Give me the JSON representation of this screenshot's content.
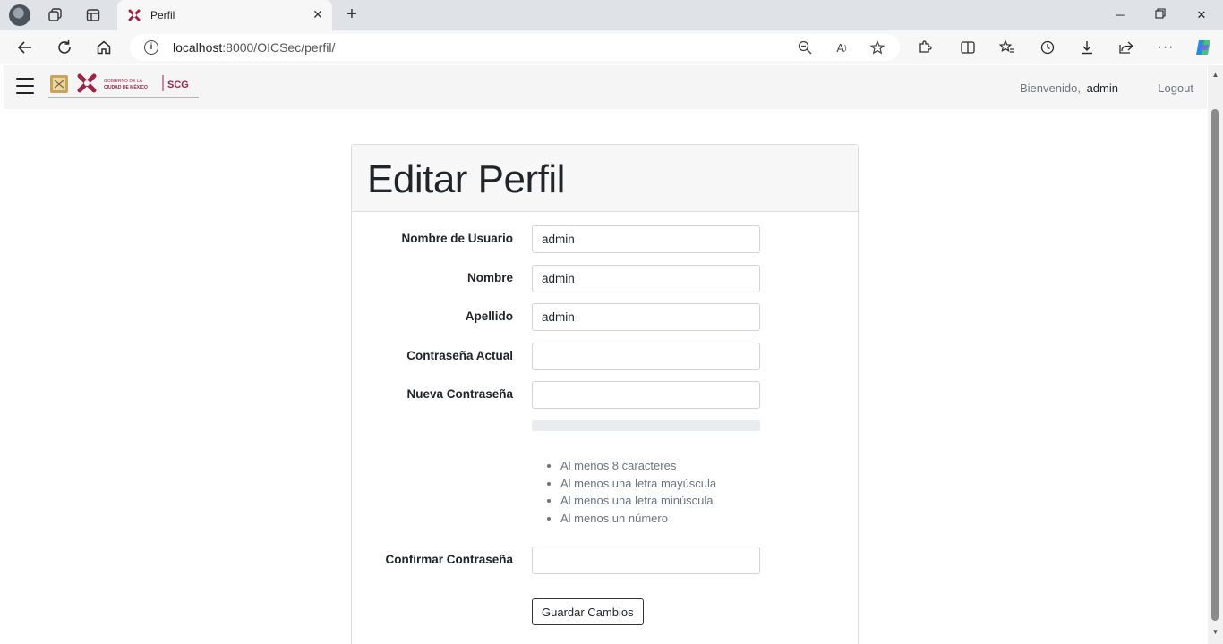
{
  "browser": {
    "tab_title": "Perfil",
    "url_host": "localhost",
    "url_path": ":8000/OICSec/perfil/"
  },
  "navbar": {
    "welcome_label": "Bienvenido,",
    "username": "admin",
    "logout_label": "Logout",
    "logo_text": "GOBIERNO DE LA CIUDAD DE MÉXICO",
    "logo_abbr": "SCG"
  },
  "form": {
    "title": "Editar Perfil",
    "fields": [
      {
        "label": "Nombre de Usuario",
        "value": "admin"
      },
      {
        "label": "Nombre",
        "value": "admin"
      },
      {
        "label": "Apellido",
        "value": "admin"
      },
      {
        "label": "Contraseña Actual",
        "value": ""
      },
      {
        "label": "Nueva Contraseña",
        "value": ""
      }
    ],
    "confirm": {
      "label": "Confirmar Contraseña",
      "value": ""
    },
    "strength_percent": 0,
    "rules": [
      "Al menos 8 caracteres",
      "Al menos una letra mayúscula",
      "Al menos una letra minúscula",
      "Al menos un número"
    ],
    "save_label": "Guardar Cambios"
  },
  "colors": {
    "brand": "#9d2449",
    "navbar_bg": "#f5f5f5",
    "strength_track": "#e9ecef"
  }
}
